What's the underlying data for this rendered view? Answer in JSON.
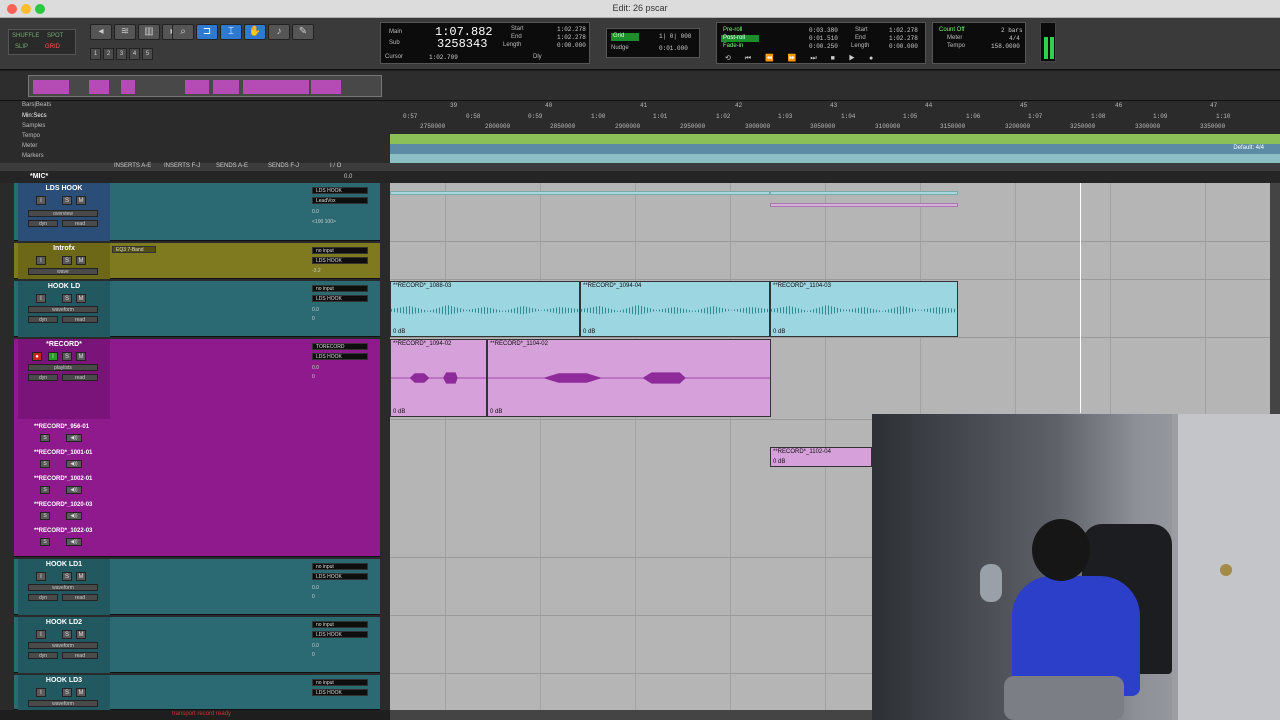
{
  "window": {
    "title": "Edit: 26 pscar"
  },
  "toolbar": {
    "modes": [
      "SHUFFLE",
      "SPOT",
      "SLIP",
      "GRID"
    ],
    "zoom_presets": [
      "1",
      "2",
      "3",
      "4",
      "5"
    ],
    "counter": {
      "main_label": "Main",
      "sub_label": "Sub",
      "main_value": "1:07.882",
      "sub_value": "3258343",
      "cursor_label": "Cursor",
      "cursor_value": "1:02.709",
      "start_label": "Start",
      "end_label": "End",
      "length_label": "Length",
      "start_value": "1:02.278",
      "end_value": "1:02.278",
      "length_value": "0:00.000",
      "dly_label": "Dly"
    },
    "grid": {
      "label": "Grid",
      "value": "1| 0| 000",
      "nudge_label": "Nudge",
      "nudge_value": "0:01.000"
    },
    "preroll": {
      "pre_label": "Pre-roll",
      "post_label": "Post-roll",
      "fade_label": "Fade-in",
      "pre_value": "0:03.380",
      "post_value": "0:01.510",
      "fade_value": "0:00.250",
      "start_label": "Start",
      "end_label": "End",
      "length_label": "Length",
      "start_value": "1:02.278",
      "end_value": "1:02.278",
      "length_value": "0:00.000"
    },
    "count": {
      "count_label": "Count Off",
      "bars_value": "2 bars",
      "meter_label": "Meter",
      "meter_value": "4/4",
      "tempo_label": "Tempo",
      "tempo_value": "158.0000"
    }
  },
  "rulers": {
    "labels": [
      "Bars|Beats",
      "Min:Secs",
      "Samples",
      "Tempo",
      "Meter",
      "Markers"
    ],
    "bars": [
      "39",
      "40",
      "41",
      "42",
      "43",
      "44",
      "45",
      "46",
      "47"
    ],
    "minsecs": [
      "0:57",
      "0:58",
      "0:59",
      "1:00",
      "1:01",
      "1:02",
      "1:03",
      "1:04",
      "1:05",
      "1:06",
      "1:07",
      "1:08",
      "1:09",
      "1:10"
    ],
    "samples": [
      "2750000",
      "2800000",
      "2850000",
      "2900000",
      "2950000",
      "3000000",
      "3050000",
      "3100000",
      "3150000",
      "3200000",
      "3250000",
      "3300000",
      "3350000"
    ],
    "meter_default": "Default: 4/4"
  },
  "columns": {
    "inserts_ae": "INSERTS A-E",
    "inserts_fj": "INSERTS F-J",
    "sends_ae": "SENDS A-E",
    "sends_fj": "SENDS F-J",
    "io": "I / O"
  },
  "selection_row": {
    "name": "*MIC*",
    "value": "0.0"
  },
  "tracks": [
    {
      "name": "LDS HOOK",
      "view": "overview",
      "mode": "dyn",
      "auto": "read",
      "io1": "LDS HOOK",
      "io2": "LeadVox",
      "vol": "0.0",
      "pan": "<100 100>",
      "insert": ""
    },
    {
      "name": "Introfx",
      "view": "wave",
      "mode": "",
      "auto": "",
      "io1": "no input",
      "io2": "LDS HOOK",
      "vol": "-3.2",
      "pan": "",
      "insert": "EQ3 7-Band"
    },
    {
      "name": "HOOK LD",
      "view": "waveform",
      "mode": "dyn",
      "auto": "read",
      "io1": "no input",
      "io2": "LDS HOOK",
      "vol": "0.0",
      "pan": "0",
      "insert": ""
    },
    {
      "name": "*RECORD*",
      "view": "playlists",
      "mode": "dyn",
      "auto": "read",
      "io1": "TORECORD",
      "io2": "LDS HOOK",
      "vol": "0.0",
      "pan": "0",
      "insert": ""
    },
    {
      "name": "HOOK LD1",
      "view": "waveform",
      "mode": "dyn",
      "auto": "read",
      "io1": "no input",
      "io2": "LDS HOOK",
      "vol": "0.0",
      "pan": "0",
      "insert": ""
    },
    {
      "name": "HOOK LD2",
      "view": "waveform",
      "mode": "dyn",
      "auto": "read",
      "io1": "no input",
      "io2": "LDS HOOK",
      "vol": "0.0",
      "pan": "0",
      "insert": ""
    },
    {
      "name": "HOOK LD3",
      "view": "waveform",
      "mode": "",
      "auto": "",
      "io1": "no input",
      "io2": "LDS HOOK",
      "vol": "",
      "pan": "",
      "insert": ""
    }
  ],
  "playlists": [
    "**RECORD*_956-01",
    "**RECORD*_1001-01",
    "**RECORD*_1002-01",
    "**RECORD*_1020-03",
    "**RECORD*_1022-03"
  ],
  "clips": {
    "hook1": "**RECORD*_1088-03",
    "hook2": "**RECORD*_1094-04",
    "hook3": "**RECORD*_1104-03",
    "rec1": "**RECORD*_1094-02",
    "rec2": "**RECORD*_1104-02",
    "pl1": "**RECORD*_1102-04",
    "gain": "0 dB"
  },
  "button_glyphs": {
    "input": "I",
    "solo": "S",
    "mute": "M",
    "record": "●",
    "speaker": "◀))"
  },
  "status": "transport record ready",
  "colors": {
    "cyan_clip": "#9cd6e0",
    "pink_clip": "#d6a0da",
    "record_track": "#8e1a8e",
    "accent": "#2e7ad1"
  }
}
